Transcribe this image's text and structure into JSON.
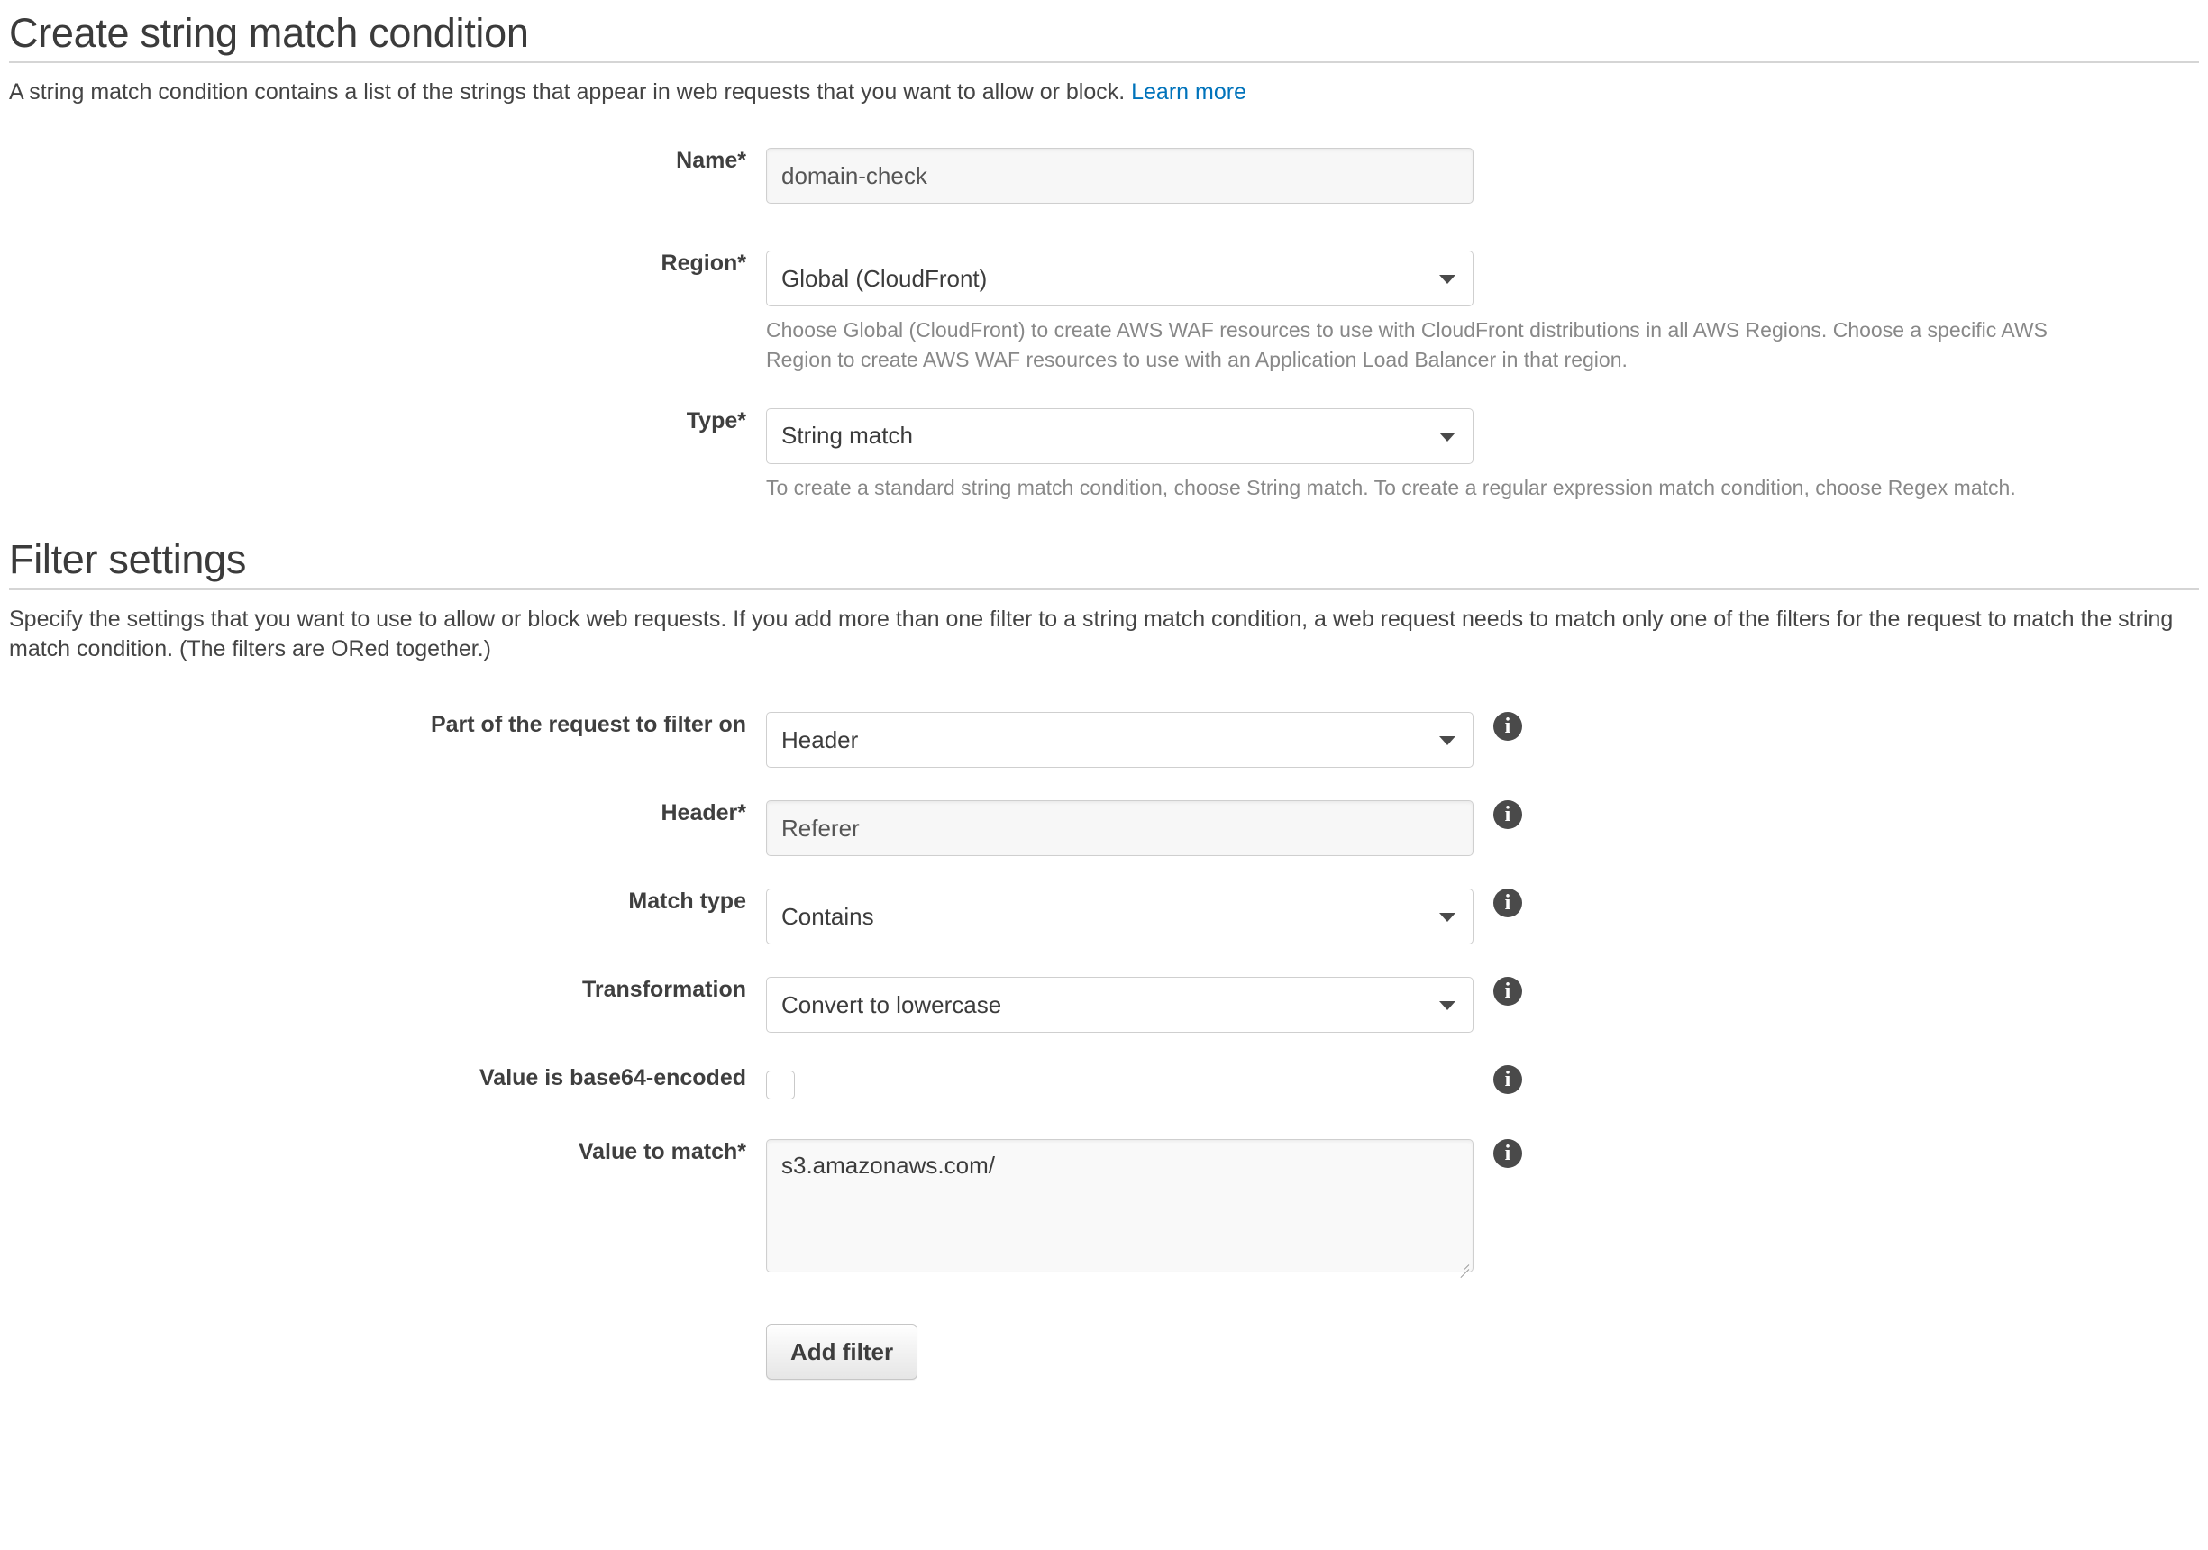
{
  "header": {
    "title": "Create string match condition",
    "description_before_link": "A string match condition contains a list of the strings that appear in web requests that you want to allow or block.",
    "learn_more_label": "Learn more"
  },
  "condition_form": {
    "name": {
      "label": "Name*",
      "value": "domain-check",
      "placeholder": "domain-check"
    },
    "region": {
      "label": "Region*",
      "value": "Global (CloudFront)",
      "help": "Choose Global (CloudFront) to create AWS WAF resources to use with CloudFront distributions in all AWS Regions. Choose a specific AWS Region to create AWS WAF resources to use with an Application Load Balancer in that region."
    },
    "type": {
      "label": "Type*",
      "value": "String match",
      "help": "To create a standard string match condition, choose String match. To create a regular expression match condition, choose Regex match."
    }
  },
  "filter_settings": {
    "title": "Filter settings",
    "description": "Specify the settings that you want to use to allow or block web requests. If you add more than one filter to a string match condition, a web request needs to match only one of the filters for the request to match the string match condition. (The filters are ORed together.)",
    "part_of_request": {
      "label": "Part of the request to filter on",
      "value": "Header",
      "info": "info-icon"
    },
    "header_field": {
      "label": "Header*",
      "value": "Referer",
      "placeholder": "Referer",
      "info": "info-icon"
    },
    "match_type": {
      "label": "Match type",
      "value": "Contains",
      "info": "info-icon"
    },
    "transformation": {
      "label": "Transformation",
      "value": "Convert to lowercase",
      "info": "info-icon"
    },
    "base64": {
      "label": "Value is base64-encoded",
      "checked": false,
      "info": "info-icon"
    },
    "value_to_match": {
      "label": "Value to match*",
      "value": "s3.amazonaws.com/",
      "info": "info-icon"
    },
    "add_filter_button": "Add filter"
  },
  "colors": {
    "link": "#0073bb",
    "heading": "#3b3b3b",
    "help_text": "#888888",
    "border": "#cfcfcf",
    "info_icon": "#4a4a4a"
  }
}
